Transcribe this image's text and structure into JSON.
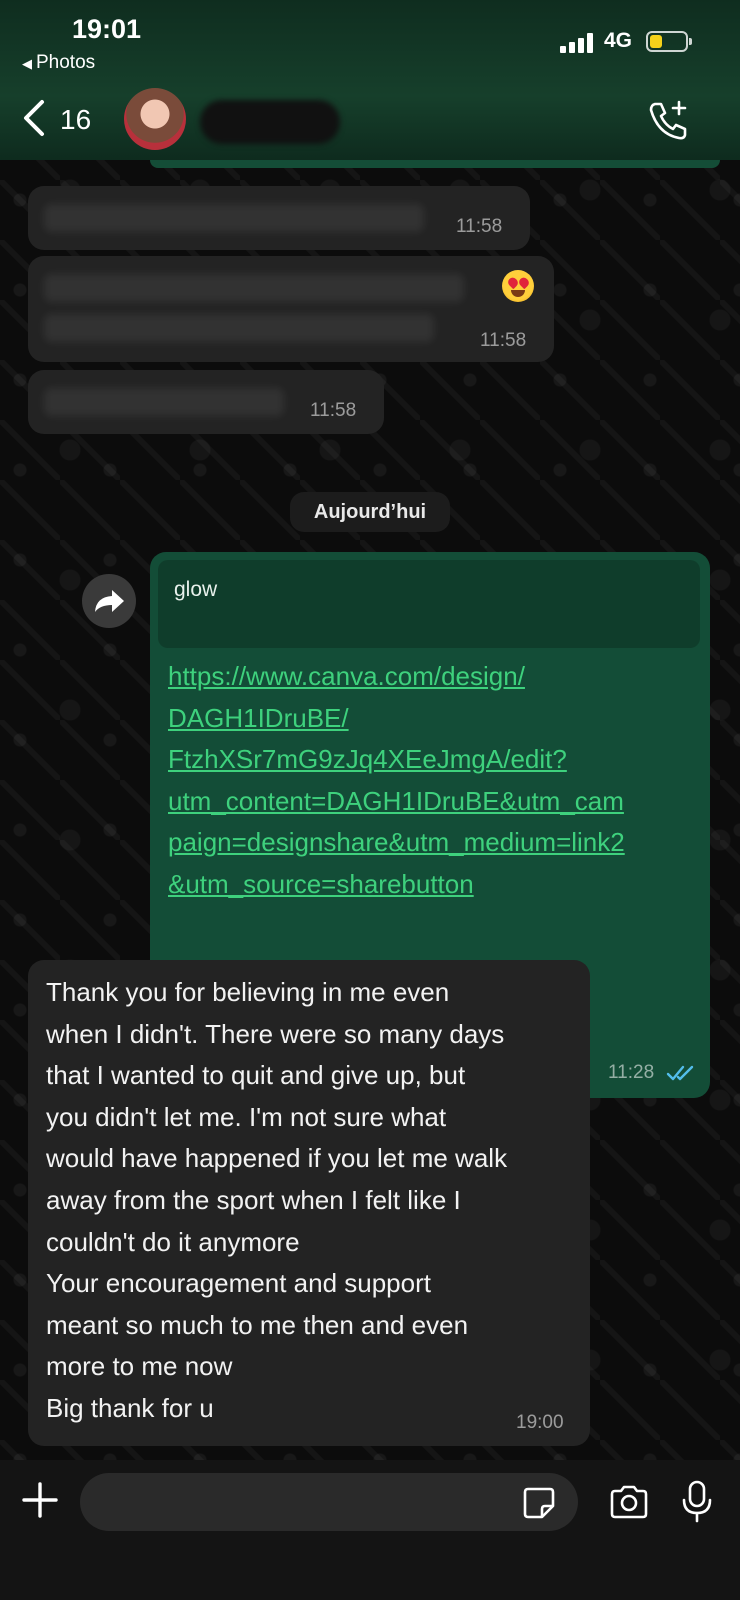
{
  "status_bar": {
    "time": "19:01",
    "back_app": "Photos",
    "network": "4G"
  },
  "header": {
    "unread_count": "16"
  },
  "messages": {
    "earlier": [
      {
        "time": "11:58"
      },
      {
        "time": "11:58"
      },
      {
        "time": "11:58"
      }
    ],
    "date_separator": "Aujourd’hui",
    "outgoing_link": {
      "preview_title": "glow",
      "url_lines": [
        "https://www.canva.com/design/",
        "DAGH1IDruBE/",
        "FtzhXSr7mG9zJq4XEeJmgA/edit?",
        "utm_content=DAGH1IDruBE&utm_cam",
        "paign=designshare&utm_medium=link2",
        "&utm_source=sharebutton"
      ],
      "time": "11:28"
    },
    "incoming_long": {
      "lines": [
        "Thank you for believing in me even",
        "when I didn't. There were so many days",
        "that I wanted to quit and give up, but",
        "you didn't let me. I'm not sure what",
        "would have happened if you let me walk",
        "away from the sport when I felt like I",
        "couldn't do it anymore",
        "Your encouragement and support",
        "meant so much to me then and even",
        "more to me now",
        "Big thank for u"
      ],
      "time": "19:00"
    }
  },
  "composer": {
    "input_value": ""
  },
  "colors": {
    "header_green": "#163f2b",
    "outgoing_bubble": "#134d37",
    "incoming_bubble": "#232323",
    "link_green": "#3ed17d",
    "read_check_blue": "#53bdeb",
    "battery_yellow": "#f5d21a"
  },
  "icons": [
    "back-chevron-icon",
    "video-call-icon",
    "forward-icon",
    "read-receipt-icon",
    "plus-icon",
    "sticker-icon",
    "camera-icon",
    "mic-icon"
  ]
}
